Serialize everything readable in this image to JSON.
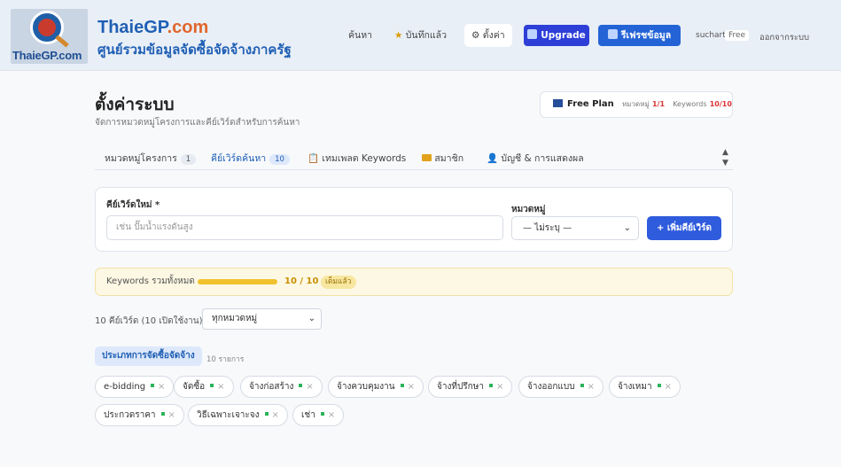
{
  "header": {
    "logo_text": "ThaieGP.com",
    "brand_main": "ThaieGP",
    "brand_suffix": ".com",
    "tagline": "ศูนย์รวมข้อมูลจัดซื้อจัดจ้างภาครัฐ",
    "nav": {
      "search": "ค้นหา",
      "saved": "บันทึกแล้ว",
      "settings": "ตั้งค่า"
    },
    "upgrade_label": "Upgrade",
    "refresh_label": "รีเฟรชข้อมูล",
    "user": "suchart",
    "plan_badge": "Free",
    "logout": "ออกจากระบบ"
  },
  "page": {
    "title": "ตั้งค่าระบบ",
    "subtitle": "จัดการหมวดหมู่โครงการและคีย์เวิร์ดสำหรับการค้นหา"
  },
  "plan_card": {
    "name": "Free Plan",
    "category_label": "หมวดหมู่",
    "category_value": "1/1",
    "keywords_label": "Keywords",
    "keywords_value": "10/10"
  },
  "tabs": [
    {
      "label": "หมวดหมู่โครงการ",
      "count": "1"
    },
    {
      "label": "คีย์เวิร์ดค้นหา",
      "count": "10"
    },
    {
      "label": "เทมเพลต Keywords"
    },
    {
      "label": "สมาชิก"
    },
    {
      "label": "บัญชี & การแสดงผล"
    }
  ],
  "form": {
    "keyword_label": "คีย์เวิร์ดใหม่ *",
    "keyword_placeholder": "เช่น ปั๊มน้ำแรงดันสูง",
    "category_label": "หมวดหมู่",
    "category_value": "— ไม่ระบุ —",
    "add_button": "+ เพิ่มคีย์เวิร์ด"
  },
  "quota": {
    "label": "Keywords รวมทั้งหมด",
    "value": "10 / 10",
    "progress": 1.0,
    "badge": "เต็มแล้ว"
  },
  "list": {
    "count_text": "10 คีย์เวิร์ด (10 เปิดใช้งาน)",
    "filter_value": "ทุกหมวดหมู่",
    "group_label": "ประเภทการจัดซื้อจัดจ้าง",
    "group_count": "10 รายการ",
    "keywords": [
      "e-bidding",
      "จัดซื้อ",
      "จ้างก่อสร้าง",
      "จ้างควบคุมงาน",
      "จ้างที่ปรึกษา",
      "จ้างออกแบบ",
      "จ้างเหมา",
      "ประกวดราคา",
      "วิธีเฉพาะเจาะจง",
      "เช่า"
    ]
  },
  "colors": {
    "primary": "#1f5fb4",
    "upgrade": "#2e3fd8",
    "accent_yellow": "#f1c22e",
    "active_green": "#2bb35a"
  }
}
